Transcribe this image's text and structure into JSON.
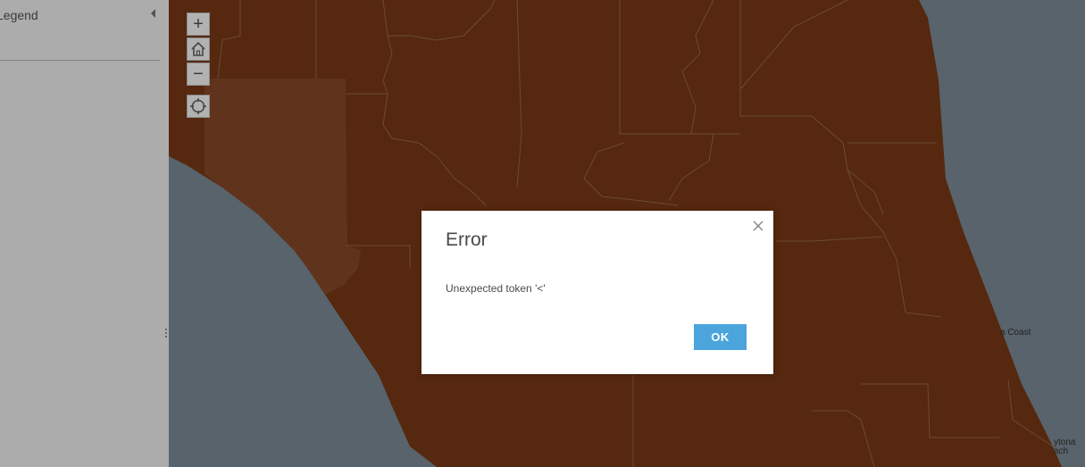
{
  "legend": {
    "title": "Legend"
  },
  "map": {
    "controls": {
      "zoom_in": "+",
      "zoom_out": "−"
    },
    "labels": {
      "coast": "a Coast",
      "daytona_1": "ytona",
      "daytona_2": "ach"
    },
    "colors": {
      "land": "#7a3a16",
      "land_highlight": "#8a4a2a",
      "water": "#7f8f9a",
      "borders": "#9a6a4f"
    }
  },
  "dialog": {
    "title": "Error",
    "message": "Unexpected token '<'",
    "ok_label": "OK",
    "accent": "#4ca4dd"
  }
}
